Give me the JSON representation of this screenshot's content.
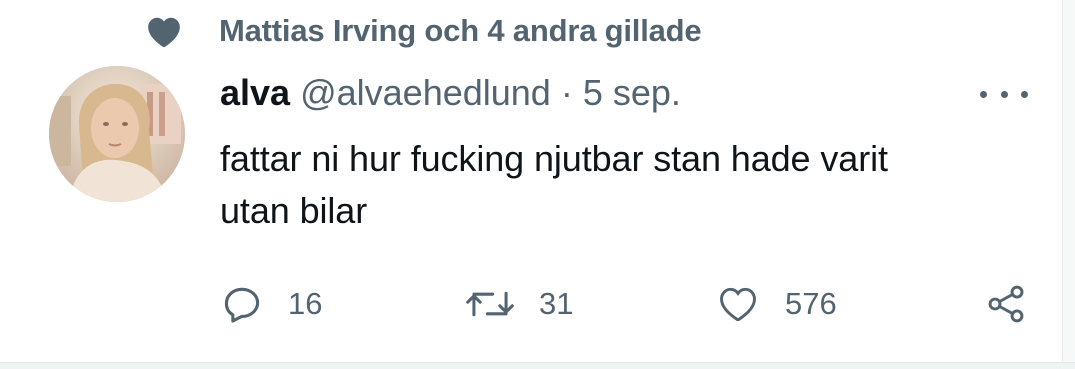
{
  "social_context": {
    "text": "Mattias Irving och 4 andra gillade",
    "icon": "heart-icon"
  },
  "tweet": {
    "author_name": "alva",
    "handle": "@alvaehedlund",
    "separator": "·",
    "date": "5 sep.",
    "text_line1": "fattar ni hur fucking njutbar stan hade varit",
    "text_line2": "utan bilar",
    "more_icon": "more-icon"
  },
  "actions": {
    "reply": {
      "icon": "reply-icon",
      "count": "16"
    },
    "retweet": {
      "icon": "retweet-icon",
      "count": "31"
    },
    "like": {
      "icon": "like-icon",
      "count": "576"
    },
    "share": {
      "icon": "share-icon"
    }
  },
  "colors": {
    "primary_text": "#0f1419",
    "secondary_text": "#536471",
    "background": "#ffffff"
  }
}
